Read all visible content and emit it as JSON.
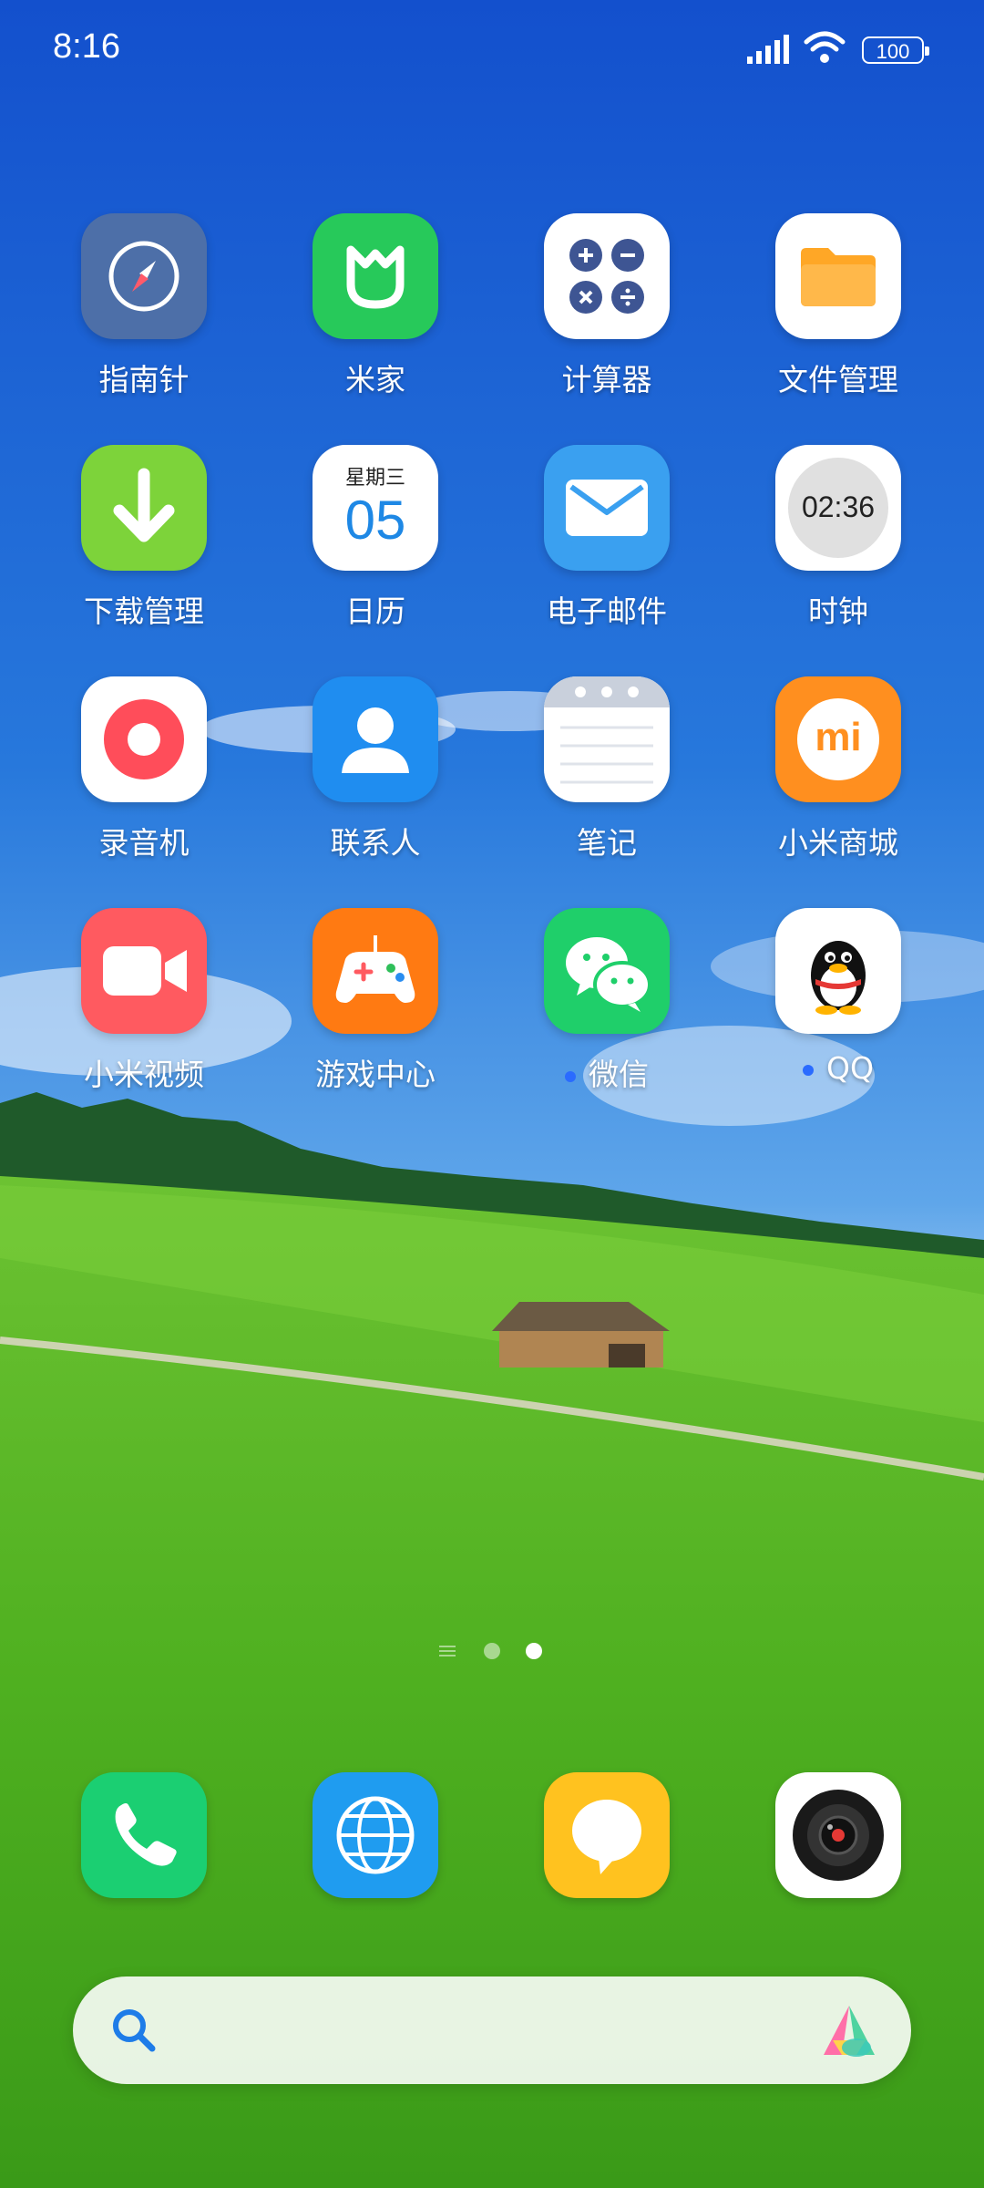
{
  "status_bar": {
    "time": "8:16",
    "battery": "100"
  },
  "apps": [
    {
      "label": "指南针",
      "icon": "compass-icon"
    },
    {
      "label": "米家",
      "icon": "mijia-icon"
    },
    {
      "label": "计算器",
      "icon": "calculator-icon"
    },
    {
      "label": "文件管理",
      "icon": "folder-icon"
    },
    {
      "label": "下载管理",
      "icon": "download-arrow-icon"
    },
    {
      "label": "日历",
      "icon": "calendar-icon",
      "weekday": "星期三",
      "day": "05"
    },
    {
      "label": "电子邮件",
      "icon": "envelope-icon"
    },
    {
      "label": "时钟",
      "icon": "clock-icon",
      "time": "02:36"
    },
    {
      "label": "录音机",
      "icon": "record-icon"
    },
    {
      "label": "联系人",
      "icon": "contact-person-icon"
    },
    {
      "label": "笔记",
      "icon": "notepad-icon"
    },
    {
      "label": "小米商城",
      "icon": "mi-logo-icon",
      "logo_text": "mi"
    },
    {
      "label": "小米视频",
      "icon": "video-camera-icon"
    },
    {
      "label": "游戏中心",
      "icon": "gamepad-icon"
    },
    {
      "label": "微信",
      "icon": "wechat-icon",
      "new_badge": true
    },
    {
      "label": "QQ",
      "icon": "qq-penguin-icon",
      "new_badge": true
    }
  ],
  "dock": [
    {
      "icon": "phone-icon"
    },
    {
      "icon": "globe-browser-icon"
    },
    {
      "icon": "message-bubble-icon"
    },
    {
      "icon": "camera-lens-icon"
    }
  ],
  "pager": {
    "pages": 3,
    "active_index": 2
  },
  "colors": {
    "sky_top": "#1553cf",
    "sky_mid": "#2a7ce0",
    "grass": "#5cb82a",
    "badge_dot": "#2a6bff"
  }
}
